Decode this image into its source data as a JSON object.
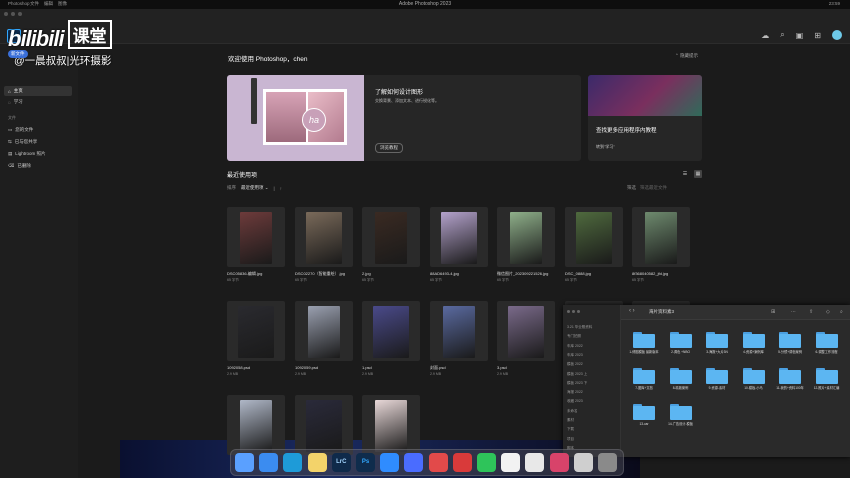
{
  "menubar": {
    "title": "Adobe Photoshop 2023",
    "left_items": [
      "Photoshop",
      "文件",
      "编辑",
      "图像",
      "窗口",
      "帮助"
    ],
    "right_text": "23:59"
  },
  "watermark": {
    "brand": "bilibili",
    "brand_suffix": "课堂",
    "handle": "@一晨叔叔|光环摄影"
  },
  "titlebar": {
    "app_icon": "Ps",
    "new_file_label": "新文件"
  },
  "sidebar": {
    "items": [
      {
        "label": "主页",
        "icon": "home-icon"
      },
      {
        "label": "学习",
        "icon": "lightbulb-icon"
      }
    ],
    "files_label": "文件",
    "file_items": [
      {
        "label": "您的文件",
        "icon": "file-icon"
      },
      {
        "label": "已与您共享",
        "icon": "shared-icon"
      },
      {
        "label": "Lightroom 照片",
        "icon": "lightroom-icon"
      },
      {
        "label": "已删除",
        "icon": "trash-icon"
      }
    ]
  },
  "main": {
    "welcome": "欢迎使用 Photoshop，chen",
    "hide_tips": "隐藏提示",
    "card1": {
      "title": "了解如何设计图形",
      "subtitle": "交换背景、添加文本、进行锐化等。",
      "button": "浏览教程",
      "ha_text": "ha"
    },
    "card2": {
      "title": "查找更多应用程序内教程",
      "subtitle": "转到\"学习\""
    },
    "recent": {
      "title": "最近使用项",
      "sort_label": "排序",
      "sort_value": "最近使用项",
      "filter_label": "筛选",
      "filter_placeholder": "筛选最近文件"
    },
    "files": [
      {
        "name": "DSC05836-编辑.jpg",
        "size": "65 字节",
        "color": "#6d3b3b"
      },
      {
        "name": "DSC02270（智能重绘）.jpg",
        "size": "65 字节",
        "color": "#7a6a5a"
      },
      {
        "name": "2.jpg",
        "size": "65 字节",
        "color": "#3a2a22"
      },
      {
        "name": "88AD6493-4.jpg",
        "size": "65 字节",
        "color": "#b4a2cc"
      },
      {
        "name": "微信图片_202309221526.jpg",
        "size": "65 字节",
        "color": "#8fb08a"
      },
      {
        "name": "DSC_0888.jpg",
        "size": "65 字节",
        "color": "#4f6a3e"
      },
      {
        "name": "8f368040582_jfd.jpg",
        "size": "65 字节",
        "color": "#6e8a6e"
      },
      {
        "name": "1092058.psd",
        "size": "2.9 MB",
        "color": "#2a2a2f"
      },
      {
        "name": "1092059.psd",
        "size": "2.9 MB",
        "color": "#9aa0b0"
      },
      {
        "name": "1.psd",
        "size": "2.9 MB",
        "color": "#4a4a8a"
      },
      {
        "name": "封面.psd",
        "size": "2.9 MB",
        "color": "#5a6aa0"
      },
      {
        "name": "3.psd",
        "size": "2.9 MB",
        "color": "#7a6a8a"
      },
      {
        "name": "",
        "size": "",
        "color": "#d8d8d8"
      },
      {
        "name": "",
        "size": "",
        "color": "#e0d0c8"
      },
      {
        "name": "",
        "size": "",
        "color": "#b0b8c8"
      },
      {
        "name": "",
        "size": "",
        "color": "#2a2a3a"
      },
      {
        "name": "",
        "size": "",
        "color": "#e8d8d8"
      }
    ]
  },
  "finder": {
    "title": "海片资料素3",
    "sidebar": [
      "3.21 毕业照资料",
      "专门拍照",
      "车库 2022",
      "车库 2023",
      "模板 2022",
      "模板 2023 上",
      "模板 2023 下",
      "海报 2022",
      "收藏 2023",
      "未命名",
      "素材",
      "下载",
      "项目",
      "脚本"
    ],
    "folders": [
      "1-修图模板 最新版本",
      "2-调色 +NBO",
      "3-海报+大片3N",
      "4-资源+案例库",
      "5-分镜+调色案例",
      "6-调整工作流程",
      "7-图库+文档",
      "8-精致案例",
      "9-资源-素材",
      "10-模板-小马",
      "11-我的+资料100年",
      "12-照片+素材汇编",
      "13-car",
      "14-广告设计-模板"
    ]
  },
  "dock": [
    {
      "name": "finder-app-icon",
      "color": "#5aa0ff",
      "label": ""
    },
    {
      "name": "safari-app-icon",
      "color": "#3b8cf0",
      "label": ""
    },
    {
      "name": "edge-app-icon",
      "color": "#1e9bd8",
      "label": ""
    },
    {
      "name": "notes-app-icon",
      "color": "#f3d36a",
      "label": ""
    },
    {
      "name": "lightroom-classic-icon",
      "color": "#0f2a4a",
      "label": "LrC"
    },
    {
      "name": "photoshop-icon",
      "color": "#0f2c4c",
      "label": "Ps"
    },
    {
      "name": "dingtalk-app-icon",
      "color": "#2f8cff",
      "label": ""
    },
    {
      "name": "feishu-app-icon",
      "color": "#4a6cff",
      "label": ""
    },
    {
      "name": "netease-music-icon",
      "color": "#e24a4a",
      "label": ""
    },
    {
      "name": "wps-app-icon",
      "color": "#d93a3a",
      "label": ""
    },
    {
      "name": "wechat-app-icon",
      "color": "#2ec45a",
      "label": ""
    },
    {
      "name": "weibo-app-icon",
      "color": "#f2f2f2",
      "label": ""
    },
    {
      "name": "clock-app-icon",
      "color": "#e8e8e8",
      "label": ""
    },
    {
      "name": "photo-booth-icon",
      "color": "#d8436a",
      "label": ""
    },
    {
      "name": "preview-app-icon",
      "color": "#cfcfcf",
      "label": ""
    },
    {
      "name": "trash-icon",
      "color": "#8a8a8a",
      "label": ""
    }
  ]
}
